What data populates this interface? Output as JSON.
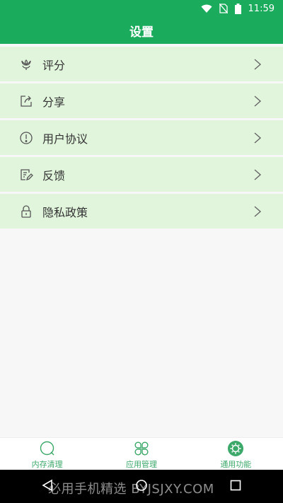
{
  "status_bar": {
    "time": "11:59"
  },
  "header": {
    "title": "设置"
  },
  "menu": {
    "items": [
      {
        "label": "评分",
        "icon": "flower-icon"
      },
      {
        "label": "分享",
        "icon": "share-icon"
      },
      {
        "label": "用户协议",
        "icon": "info-circle-icon"
      },
      {
        "label": "反馈",
        "icon": "edit-note-icon"
      },
      {
        "label": "隐私政策",
        "icon": "lock-icon"
      }
    ]
  },
  "bottom_nav": {
    "items": [
      {
        "label": "内存清理",
        "icon": "search-circle-icon"
      },
      {
        "label": "应用管理",
        "icon": "clover-icon"
      },
      {
        "label": "通用功能",
        "icon": "gear-icon"
      }
    ]
  },
  "watermark": {
    "text": "必用手机精选 BYJSJXY.COM"
  },
  "colors": {
    "primary": "#1aab5c",
    "item_bg": "#e1f5dc",
    "nav_accent": "#3ca86a"
  }
}
